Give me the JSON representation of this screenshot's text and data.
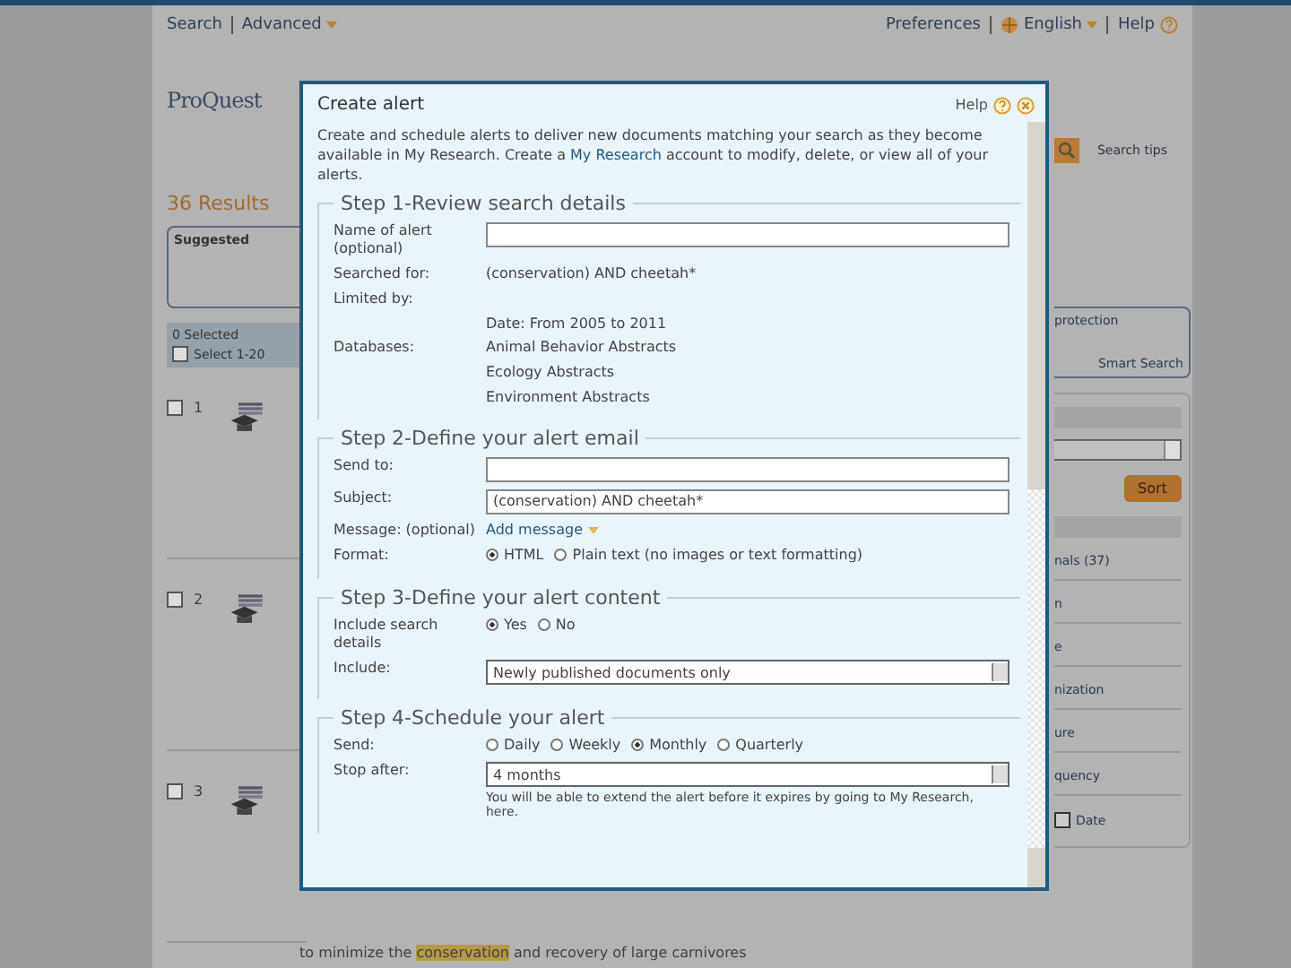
{
  "top_nav": {
    "left": [
      {
        "label": "Search",
        "dropdown": false
      },
      {
        "label": "Advanced",
        "dropdown": true
      }
    ],
    "right": [
      {
        "label": "Preferences",
        "dropdown": false
      },
      {
        "label": "English",
        "dropdown": true
      },
      {
        "label": "Help",
        "dropdown": false
      }
    ]
  },
  "logo": "ProQuest",
  "search_tips": "Search tips",
  "results_heading": "36 Results",
  "suggested_subjects": "Suggested",
  "suggestion_box": {
    "line_1": "protection",
    "line_2": "Smart Search"
  },
  "selection_bar": {
    "count": "0 Selected",
    "select_all": "Select 1-20",
    "checked": false
  },
  "results": [
    {
      "number": "1",
      "checked": false
    },
    {
      "number": "2",
      "checked": false
    },
    {
      "number": "3",
      "checked": false
    }
  ],
  "snippet": "to minimize the **conservation** and recovery of large carnivores",
  "sidebar": {
    "sort_button": "Sort",
    "items": [
      "nals (37)",
      "n",
      "e",
      "nization",
      "ure",
      "quency"
    ],
    "last_item": "Date"
  },
  "dialog": {
    "title": "Create alert",
    "help": "Help",
    "intro": "Create and schedule alerts to deliver new documents matching your search as they become available in My Research. Create a ",
    "intro_link": "My Research",
    "intro_end": " account to modify, delete, or view all of your alerts.",
    "steps": [
      {
        "legend": "Step 1-Review search details",
        "fields": [
          {
            "kind": "input",
            "label": "Name of alert (optional)"
          },
          {
            "kind": "text",
            "label": "Searched for:",
            "value": "(conservation) AND cheetah*"
          },
          {
            "kind": "text",
            "label": "Limited by:"
          },
          {
            "kind": "text",
            "value": "Date: From 2005 to 2011"
          },
          {
            "kind": "list",
            "label": "Databases:",
            "values": [
              "Animal Behavior Abstracts",
              "Ecology Abstracts",
              "Environment Abstracts"
            ]
          }
        ]
      },
      {
        "legend": "Step 2-Define your alert email",
        "fields": [
          {
            "kind": "input",
            "label": "Send to:"
          },
          {
            "kind": "input",
            "label": "Subject:",
            "value": "(conservation) AND cheetah*"
          },
          {
            "kind": "link",
            "label": "Message: (optional)",
            "value": "Add message"
          },
          {
            "kind": "radio",
            "label": "Format:",
            "options": [
              {
                "label": "HTML",
                "selected": true
              },
              {
                "label": "Plain text (no images or text formatting)",
                "selected": false
              }
            ]
          }
        ]
      },
      {
        "legend": "Step 3-Define your alert content",
        "fields": [
          {
            "kind": "radio",
            "label": "Include search details",
            "options": [
              {
                "label": "Yes",
                "selected": true
              },
              {
                "label": "No",
                "selected": false
              }
            ]
          },
          {
            "kind": "select",
            "label": "Include:",
            "value": "Newly published documents only"
          }
        ]
      },
      {
        "legend": "Step 4-Schedule your alert",
        "fields": [
          {
            "kind": "radio",
            "label": "Send:",
            "options": [
              {
                "label": "Daily",
                "selected": false
              },
              {
                "label": "Weekly",
                "selected": false
              },
              {
                "label": "Monthly",
                "selected": true
              },
              {
                "label": "Quarterly",
                "selected": false
              }
            ]
          },
          {
            "kind": "select",
            "label": "Stop after:",
            "value": "4 months",
            "note": "You will be able to extend the alert before it expires by going to My Research, here."
          }
        ]
      }
    ]
  }
}
